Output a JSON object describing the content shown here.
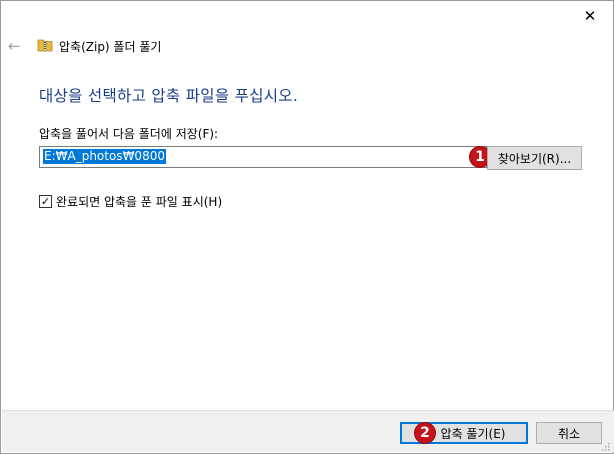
{
  "dialog": {
    "title": "압축(Zip) 폴더 풀기",
    "close_glyph": "✕",
    "back_glyph": "←",
    "heading": "대상을 선택하고 압축 파일을 푸십시오.",
    "path_label": "압축을 풀어서 다음 폴더에 저장(F):",
    "path_value": "E:₩A_photos₩0800",
    "browse_label": "찾아보기(R)...",
    "show_files_label": "완료되면 압축을 푼 파일 표시(H)",
    "show_files_checked": true,
    "check_glyph": "✓",
    "extract_label": "압축 풀기(E)",
    "cancel_label": "취소",
    "badges": [
      "1",
      "2"
    ],
    "icons": {
      "folder": "zip-folder-icon",
      "close": "close-icon",
      "back": "back-arrow-icon"
    },
    "colors": {
      "heading": "#1a3e8c",
      "selection": "#0078d7",
      "badge": "#c5121b",
      "footer": "#f0f0f0"
    }
  }
}
